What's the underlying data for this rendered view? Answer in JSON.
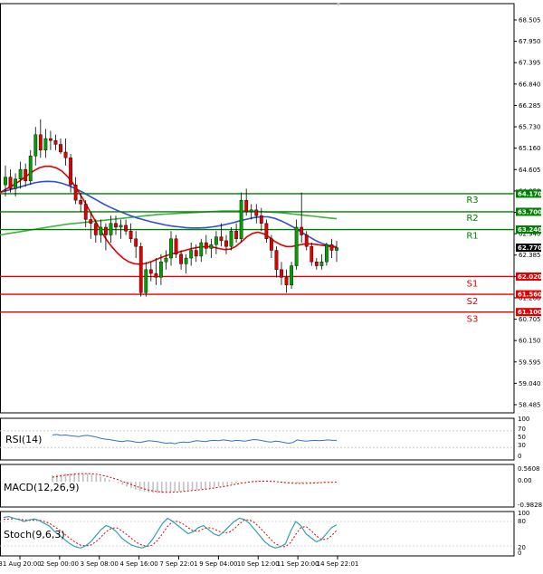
{
  "chart_data": [
    {
      "type": "candlestick",
      "panel": "price",
      "title": "",
      "ylim": [
        58.485,
        69.1
      ],
      "y_ticks": [
        "68.505",
        "67.950",
        "67.395",
        "66.840",
        "66.285",
        "65.730",
        "65.160",
        "64.605",
        "64.050",
        "63.495",
        "62.940",
        "62.385",
        "61.830",
        "61.260",
        "60.705",
        "60.150",
        "59.595",
        "59.040",
        "58.485"
      ],
      "x_ticks": [
        "31 Aug 20:00",
        "2 Sep 00:00",
        "3 Sep 08:00",
        "4 Sep 16:00",
        "7 Sep 22:01",
        "9 Sep 04:00",
        "10 Sep 12:00",
        "11 Sep 20:00",
        "14 Sep 22:01"
      ],
      "ohlc": [
        [
          64.4,
          64.9,
          64.1,
          64.6
        ],
        [
          64.6,
          64.8,
          64.2,
          64.3
        ],
        [
          64.3,
          64.7,
          64.1,
          64.55
        ],
        [
          64.55,
          65.0,
          64.3,
          64.8
        ],
        [
          64.8,
          64.95,
          64.35,
          64.5
        ],
        [
          64.5,
          65.3,
          64.4,
          65.15
        ],
        [
          65.15,
          65.9,
          64.9,
          65.7
        ],
        [
          65.7,
          66.1,
          65.1,
          65.3
        ],
        [
          65.3,
          65.85,
          65.1,
          65.6
        ],
        [
          65.6,
          65.8,
          65.3,
          65.55
        ],
        [
          65.55,
          65.7,
          65.3,
          65.45
        ],
        [
          65.45,
          65.6,
          65.2,
          65.25
        ],
        [
          65.25,
          65.6,
          64.9,
          65.1
        ],
        [
          65.1,
          65.2,
          64.2,
          64.4
        ],
        [
          64.4,
          64.6,
          63.9,
          64.0
        ],
        [
          64.0,
          64.2,
          63.7,
          63.9
        ],
        [
          63.9,
          64.0,
          63.3,
          63.5
        ],
        [
          63.5,
          63.7,
          63.0,
          63.4
        ],
        [
          63.4,
          63.5,
          62.9,
          63.1
        ],
        [
          63.1,
          63.5,
          62.9,
          63.3
        ],
        [
          63.3,
          63.4,
          62.7,
          63.1
        ],
        [
          63.1,
          63.6,
          62.9,
          63.4
        ],
        [
          63.4,
          63.6,
          63.1,
          63.3
        ],
        [
          63.3,
          63.5,
          63.0,
          63.35
        ],
        [
          63.35,
          63.5,
          63.1,
          63.2
        ],
        [
          63.2,
          63.4,
          62.9,
          63.0
        ],
        [
          63.0,
          63.2,
          62.5,
          62.8
        ],
        [
          62.8,
          62.9,
          61.5,
          61.6
        ],
        [
          61.6,
          62.4,
          61.5,
          62.2
        ],
        [
          62.2,
          62.4,
          61.9,
          62.1
        ],
        [
          62.1,
          62.5,
          61.8,
          62.0
        ],
        [
          62.0,
          62.6,
          61.8,
          62.4
        ],
        [
          62.4,
          62.7,
          62.2,
          62.5
        ],
        [
          62.5,
          63.2,
          62.3,
          63.0
        ],
        [
          63.0,
          63.1,
          62.5,
          62.6
        ],
        [
          62.6,
          62.7,
          62.2,
          62.35
        ],
        [
          62.35,
          62.6,
          62.1,
          62.5
        ],
        [
          62.5,
          62.9,
          62.3,
          62.7
        ],
        [
          62.7,
          62.85,
          62.4,
          62.55
        ],
        [
          62.55,
          63.0,
          62.4,
          62.9
        ],
        [
          62.9,
          63.1,
          62.6,
          62.75
        ],
        [
          62.75,
          63.0,
          62.5,
          62.85
        ],
        [
          62.85,
          63.2,
          62.6,
          63.05
        ],
        [
          63.05,
          63.4,
          62.8,
          62.95
        ],
        [
          62.95,
          63.1,
          62.6,
          62.8
        ],
        [
          62.8,
          63.3,
          62.7,
          63.2
        ],
        [
          63.2,
          63.4,
          62.9,
          63.0
        ],
        [
          63.0,
          64.2,
          62.9,
          64.0
        ],
        [
          64.0,
          64.3,
          63.6,
          63.7
        ],
        [
          63.7,
          63.9,
          63.5,
          63.75
        ],
        [
          63.75,
          63.9,
          63.4,
          63.6
        ],
        [
          63.6,
          63.8,
          63.2,
          63.4
        ],
        [
          63.4,
          63.5,
          62.9,
          63.0
        ],
        [
          63.0,
          63.1,
          62.5,
          62.7
        ],
        [
          62.7,
          62.8,
          62.0,
          62.2
        ],
        [
          62.2,
          62.4,
          61.8,
          62.0
        ],
        [
          62.0,
          62.2,
          61.6,
          61.8
        ],
        [
          61.8,
          62.4,
          61.7,
          62.3
        ],
        [
          62.3,
          63.5,
          62.2,
          63.3
        ],
        [
          63.3,
          64.2,
          62.9,
          63.1
        ],
        [
          63.1,
          63.2,
          62.7,
          62.8
        ],
        [
          62.8,
          62.9,
          62.3,
          62.4
        ],
        [
          62.4,
          62.5,
          62.2,
          62.3
        ],
        [
          62.3,
          62.6,
          62.2,
          62.4
        ],
        [
          62.4,
          62.9,
          62.3,
          62.85
        ],
        [
          62.85,
          63.0,
          62.5,
          62.7
        ],
        [
          62.7,
          62.95,
          62.4,
          62.77
        ]
      ],
      "ma_red": [
        64.2,
        64.28,
        64.36,
        64.45,
        64.55,
        64.66,
        64.76,
        64.84,
        64.88,
        64.88,
        64.84,
        64.76,
        64.62,
        64.44,
        64.22,
        63.98,
        63.72,
        63.46,
        63.2,
        62.97,
        62.78,
        62.62,
        62.49,
        62.4,
        62.35,
        62.34,
        62.36,
        62.41,
        62.47,
        62.53,
        62.58,
        62.62,
        62.66,
        62.7,
        62.74,
        62.77,
        62.79,
        62.8,
        62.78,
        62.75,
        62.72,
        62.73,
        62.8,
        62.92,
        63.05,
        63.14,
        63.17,
        63.13,
        63.04,
        62.93,
        62.85,
        62.8,
        62.8,
        62.83,
        62.86,
        62.87,
        62.86,
        62.84,
        62.82,
        62.8,
        62.78
      ],
      "ma_blue": [
        64.2,
        64.25,
        64.3,
        64.35,
        64.4,
        64.45,
        64.48,
        64.49,
        64.48,
        64.44,
        64.38,
        64.3,
        64.21,
        64.11,
        64.01,
        63.91,
        63.82,
        63.74,
        63.67,
        63.6,
        63.54,
        63.49,
        63.44,
        63.4,
        63.36,
        63.33,
        63.31,
        63.29,
        63.28,
        63.28,
        63.29,
        63.31,
        63.34,
        63.38,
        63.42,
        63.47,
        63.51,
        63.55,
        63.57,
        63.57,
        63.53,
        63.46,
        63.37,
        63.27,
        63.16,
        63.05,
        62.95,
        62.87,
        62.82,
        62.79
      ],
      "ma_green": [
        63.1,
        63.13,
        63.16,
        63.19,
        63.22,
        63.25,
        63.28,
        63.31,
        63.34,
        63.37,
        63.39,
        63.41,
        63.43,
        63.45,
        63.47,
        63.49,
        63.51,
        63.53,
        63.55,
        63.57,
        63.59,
        63.61,
        63.63,
        63.64,
        63.65,
        63.66,
        63.67,
        63.68,
        63.69,
        63.7,
        63.71,
        63.72,
        63.72,
        63.72,
        63.72,
        63.72,
        63.71,
        63.7,
        63.69,
        63.68,
        63.66,
        63.64,
        63.62,
        63.6,
        63.58,
        63.56,
        63.54,
        63.52
      ],
      "levels": [
        {
          "name": "R3",
          "value": 64.17,
          "tag": "64.170",
          "color": "#008000"
        },
        {
          "name": "R2",
          "value": 63.7,
          "tag": "63.700",
          "color": "#008000"
        },
        {
          "name": "R1",
          "value": 63.24,
          "tag": "63.240",
          "color": "#008000"
        },
        {
          "name": "S1",
          "value": 62.02,
          "tag": "62.020",
          "color": "#e00000"
        },
        {
          "name": "S2",
          "value": 61.56,
          "tag": "61.560",
          "color": "#e00000"
        },
        {
          "name": "S3",
          "value": 61.1,
          "tag": "61.100",
          "color": "#e00000"
        }
      ],
      "current_price": {
        "value": 62.77,
        "tag": "62.770",
        "color": "#000000"
      },
      "colors": {
        "bull": "#00a000",
        "bear": "#e00000",
        "ma_red": "#e00000",
        "ma_blue": "#3050d0",
        "ma_green": "#40b040"
      }
    },
    {
      "type": "line",
      "panel": "rsi",
      "title": "RSI(14)",
      "ylim": [
        0,
        100
      ],
      "y_ticks": [
        "100",
        "70",
        "50",
        "30",
        "0"
      ],
      "levels": [
        70,
        30
      ],
      "values": [
        60,
        61,
        59,
        60,
        58,
        57,
        56,
        58,
        59,
        57,
        55,
        52,
        50,
        49,
        47,
        45,
        44,
        46,
        45,
        43,
        42,
        44,
        46,
        45,
        44,
        42,
        40,
        41,
        39,
        42,
        43,
        42,
        44,
        46,
        45,
        44,
        46,
        47,
        46,
        48,
        47,
        45,
        47,
        46,
        45,
        47,
        49,
        48,
        46,
        44,
        43,
        45,
        44,
        42,
        40,
        42,
        48,
        46,
        45,
        46,
        47,
        46,
        47,
        48,
        47,
        47
      ],
      "color": "#3070d0"
    },
    {
      "type": "bar_line",
      "panel": "macd",
      "title": "MACD(12,26,9)",
      "ylim": [
        -0.9828,
        0.5608
      ],
      "y_ticks": [
        "0.5608",
        "0.00",
        "-0.9828"
      ],
      "histogram": [
        0.3,
        0.32,
        0.34,
        0.36,
        0.37,
        0.38,
        0.38,
        0.37,
        0.35,
        0.32,
        0.28,
        0.23,
        0.17,
        0.1,
        0.03,
        -0.05,
        -0.13,
        -0.21,
        -0.28,
        -0.34,
        -0.39,
        -0.43,
        -0.46,
        -0.48,
        -0.49,
        -0.49,
        -0.48,
        -0.46,
        -0.44,
        -0.42,
        -0.4,
        -0.38,
        -0.36,
        -0.34,
        -0.32,
        -0.3,
        -0.27,
        -0.24,
        -0.21,
        -0.18,
        -0.14,
        -0.1,
        -0.06,
        -0.03,
        0.0,
        0.02,
        0.04,
        0.05,
        0.05,
        0.04,
        0.02,
        0.0,
        -0.02,
        -0.04,
        -0.06,
        -0.07,
        -0.08,
        -0.08,
        -0.07,
        -0.06,
        -0.05,
        -0.04,
        -0.03,
        -0.02,
        -0.01,
        0.0
      ],
      "signal": [
        0.2,
        0.23,
        0.26,
        0.29,
        0.31,
        0.33,
        0.35,
        0.36,
        0.36,
        0.35,
        0.33,
        0.3,
        0.26,
        0.21,
        0.15,
        0.09,
        0.02,
        -0.05,
        -0.12,
        -0.19,
        -0.25,
        -0.31,
        -0.36,
        -0.4,
        -0.43,
        -0.45,
        -0.46,
        -0.46,
        -0.45,
        -0.44,
        -0.42,
        -0.4,
        -0.38,
        -0.36,
        -0.34,
        -0.32,
        -0.3,
        -0.27,
        -0.24,
        -0.21,
        -0.18,
        -0.14,
        -0.1,
        -0.07,
        -0.04,
        -0.01,
        0.01,
        0.02,
        0.03,
        0.03,
        0.02,
        0.01,
        -0.01,
        -0.03,
        -0.05,
        -0.06,
        -0.07,
        -0.07,
        -0.07,
        -0.06,
        -0.05,
        -0.04,
        -0.03,
        -0.02,
        -0.02,
        -0.01
      ],
      "colors": {
        "histogram": "#c0c0c0",
        "signal": "#e00000"
      }
    },
    {
      "type": "line",
      "panel": "stoch",
      "title": "Stoch(9,6,3)",
      "ylim": [
        0,
        100
      ],
      "y_ticks": [
        "100",
        "80",
        "20",
        "0"
      ],
      "levels": [
        80,
        20
      ],
      "k": [
        90,
        92,
        88,
        85,
        80,
        84,
        86,
        82,
        75,
        68,
        55,
        45,
        35,
        25,
        18,
        15,
        20,
        30,
        45,
        60,
        70,
        65,
        55,
        40,
        30,
        22,
        18,
        15,
        20,
        35,
        55,
        75,
        88,
        80,
        70,
        60,
        50,
        55,
        65,
        70,
        60,
        50,
        45,
        55,
        68,
        80,
        88,
        85,
        75,
        60,
        45,
        30,
        20,
        15,
        18,
        25,
        55,
        80,
        70,
        50,
        40,
        30,
        35,
        50,
        65,
        72
      ],
      "d": [
        85,
        86,
        87,
        86,
        84,
        83,
        83,
        83,
        80,
        75,
        67,
        58,
        48,
        38,
        29,
        22,
        20,
        22,
        30,
        42,
        55,
        63,
        65,
        58,
        48,
        38,
        28,
        22,
        19,
        22,
        33,
        50,
        68,
        80,
        80,
        74,
        65,
        57,
        56,
        62,
        65,
        62,
        56,
        52,
        53,
        62,
        74,
        84,
        84,
        77,
        65,
        52,
        38,
        26,
        19,
        18,
        28,
        48,
        65,
        68,
        58,
        45,
        36,
        36,
        45,
        58
      ],
      "colors": {
        "k": "#30a0b0",
        "d": "#e00000"
      }
    }
  ]
}
